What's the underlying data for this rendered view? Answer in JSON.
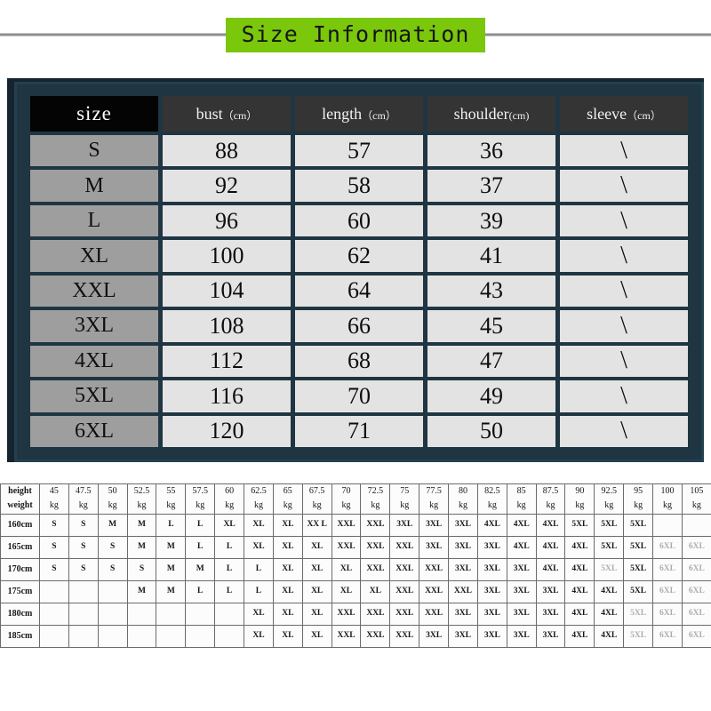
{
  "title": {
    "text": "Size Information",
    "chip_color": "#7ac70c",
    "rule_color": "#8e8e8e"
  },
  "panel": {
    "background": "#1f3542",
    "border_color": "#24404f",
    "header_background": "#343434",
    "size_header_background": "#000000",
    "size_cell_background": "#9e9e9e",
    "value_cell_background": "#e3e3e3"
  },
  "size_table": {
    "headers": [
      {
        "label": "size",
        "unit": ""
      },
      {
        "label": "bust",
        "unit": "（cm）"
      },
      {
        "label": "length",
        "unit": "（cm）"
      },
      {
        "label": "shoulder",
        "unit": "(cm)"
      },
      {
        "label": "sleeve",
        "unit": "（cm）"
      }
    ],
    "rows": [
      {
        "size": "S",
        "bust": "88",
        "length": "57",
        "shoulder": "36",
        "sleeve": "\\"
      },
      {
        "size": "M",
        "bust": "92",
        "length": "58",
        "shoulder": "37",
        "sleeve": "\\"
      },
      {
        "size": "L",
        "bust": "96",
        "length": "60",
        "shoulder": "39",
        "sleeve": "\\"
      },
      {
        "size": "XL",
        "bust": "100",
        "length": "62",
        "shoulder": "41",
        "sleeve": "\\"
      },
      {
        "size": "XXL",
        "bust": "104",
        "length": "64",
        "shoulder": "43",
        "sleeve": "\\"
      },
      {
        "size": "3XL",
        "bust": "108",
        "length": "66",
        "shoulder": "45",
        "sleeve": "\\"
      },
      {
        "size": "4XL",
        "bust": "112",
        "length": "68",
        "shoulder": "47",
        "sleeve": "\\"
      },
      {
        "size": "5XL",
        "bust": "116",
        "length": "70",
        "shoulder": "49",
        "sleeve": "\\"
      },
      {
        "size": "6XL",
        "bust": "120",
        "length": "71",
        "shoulder": "50",
        "sleeve": "\\"
      }
    ]
  },
  "height_weight_table": {
    "corner_top": "height",
    "corner_bottom": "weight",
    "weight_unit": "kg",
    "weights": [
      "45",
      "47.5",
      "50",
      "52.5",
      "55",
      "57.5",
      "60",
      "62.5",
      "65",
      "67.5",
      "70",
      "72.5",
      "75",
      "77.5",
      "80",
      "82.5",
      "85",
      "87.5",
      "90",
      "92.5",
      "95",
      "100",
      "105"
    ],
    "heights": [
      "160cm",
      "165cm",
      "170cm",
      "175cm",
      "180cm",
      "185cm"
    ],
    "cells": [
      [
        "S",
        "S",
        "M",
        "M",
        "L",
        "L",
        "XL",
        "XL",
        "XL",
        "XX L",
        "XXL",
        "XXL",
        "3XL",
        "3XL",
        "3XL",
        "4XL",
        "4XL",
        "4XL",
        "5XL",
        "5XL",
        "5XL",
        "",
        ""
      ],
      [
        "S",
        "S",
        "S",
        "M",
        "M",
        "L",
        "L",
        "XL",
        "XL",
        "XL",
        "XXL",
        "XXL",
        "XXL",
        "3XL",
        "3XL",
        "3XL",
        "4XL",
        "4XL",
        "4XL",
        "5XL",
        "5XL",
        "6XL",
        "6XL"
      ],
      [
        "S",
        "S",
        "S",
        "S",
        "M",
        "M",
        "L",
        "L",
        "XL",
        "XL",
        "XL",
        "XXL",
        "XXL",
        "XXL",
        "3XL",
        "3XL",
        "3XL",
        "4XL",
        "4XL",
        "5XL",
        "5XL",
        "6XL",
        "6XL"
      ],
      [
        "",
        "",
        "",
        "M",
        "M",
        "L",
        "L",
        "L",
        "XL",
        "XL",
        "XL",
        "XL",
        "XXL",
        "XXL",
        "XXL",
        "3XL",
        "3XL",
        "3XL",
        "4XL",
        "4XL",
        "5XL",
        "6XL",
        "6XL"
      ],
      [
        "",
        "",
        "",
        "",
        "",
        "",
        "",
        "XL",
        "XL",
        "XL",
        "XXL",
        "XXL",
        "XXL",
        "XXL",
        "3XL",
        "3XL",
        "3XL",
        "3XL",
        "4XL",
        "4XL",
        "5XL",
        "6XL",
        "6XL"
      ],
      [
        "",
        "",
        "",
        "",
        "",
        "",
        "",
        "XL",
        "XL",
        "XL",
        "XXL",
        "XXL",
        "XXL",
        "3XL",
        "3XL",
        "3XL",
        "3XL",
        "3XL",
        "4XL",
        "4XL",
        "5XL",
        "6XL",
        "6XL"
      ]
    ],
    "faded_cells": [
      [],
      [
        21,
        22
      ],
      [
        19,
        21,
        22
      ],
      [
        21,
        22
      ],
      [
        20,
        21,
        22
      ],
      [
        20,
        21,
        22
      ]
    ]
  }
}
